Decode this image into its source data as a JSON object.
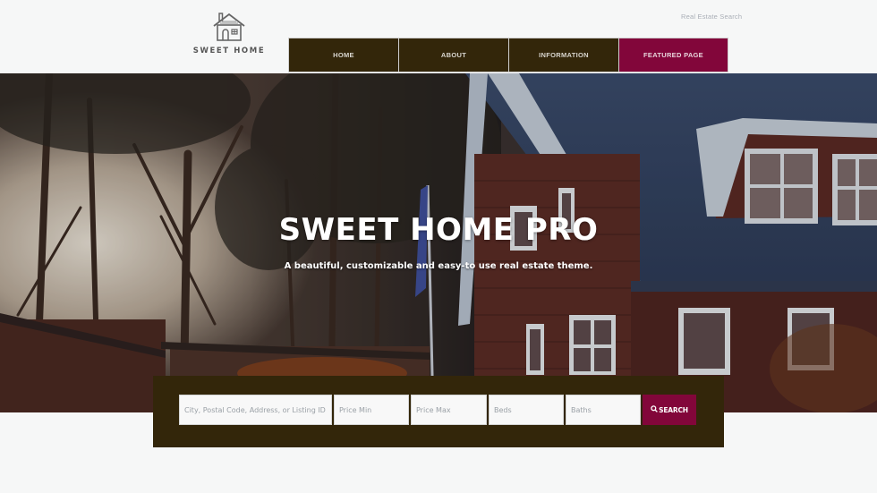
{
  "brand": {
    "logo_icon": "house-icon",
    "name": "SWEET HOME"
  },
  "top_link": "Real Estate Search",
  "nav": {
    "items": [
      {
        "label": "HOME"
      },
      {
        "label": "ABOUT"
      },
      {
        "label": "INFORMATION"
      },
      {
        "label": "FEATURED PAGE"
      }
    ]
  },
  "hero": {
    "title": "SWEET HOME PRO",
    "subtitle": "A beautiful, customizable and easy-to use real estate theme."
  },
  "search": {
    "location_placeholder": "City, Postal Code, Address, or Listing ID",
    "price_min_placeholder": "Price Min",
    "price_max_placeholder": "Price Max",
    "beds_placeholder": "Beds",
    "baths_placeholder": "Baths",
    "button_label": "SEARCH",
    "button_icon": "search-icon"
  },
  "colors": {
    "nav_bg": "#33260a",
    "accent": "#82063a",
    "page_bg": "#f6f7f7"
  }
}
